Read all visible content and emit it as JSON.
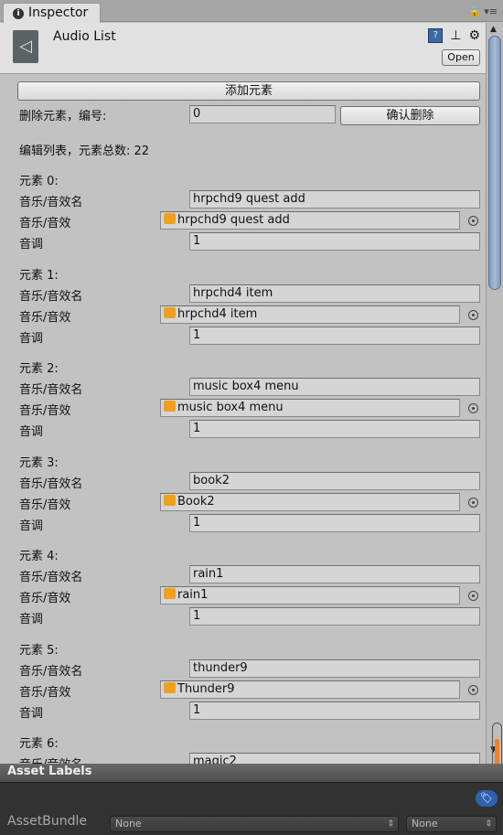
{
  "tab": {
    "label": "Inspector"
  },
  "header": {
    "title": "Audio List",
    "open_label": "Open"
  },
  "controls": {
    "add_label": "添加元素",
    "delete_label": "删除元素，编号:",
    "delete_index": "0",
    "confirm_delete_label": "确认删除",
    "list_summary": "编辑列表，元素总数: 22"
  },
  "field_labels": {
    "name": "音乐/音效名",
    "clip": "音乐/音效",
    "pitch": "音调"
  },
  "elements": [
    {
      "header": "元素 0:",
      "name": "hrpchd9 quest add",
      "clip": "hrpchd9 quest add",
      "pitch": "1"
    },
    {
      "header": "元素 1:",
      "name": "hrpchd4 item",
      "clip": "hrpchd4 item",
      "pitch": "1"
    },
    {
      "header": "元素 2:",
      "name": "music box4 menu",
      "clip": "music box4 menu",
      "pitch": "1"
    },
    {
      "header": "元素 3:",
      "name": "book2",
      "clip": "Book2",
      "pitch": "1"
    },
    {
      "header": "元素 4:",
      "name": "rain1",
      "clip": "rain1",
      "pitch": "1"
    },
    {
      "header": "元素 5:",
      "name": "thunder9",
      "clip": "Thunder9",
      "pitch": "1"
    },
    {
      "header": "元素 6:",
      "name": "magic2",
      "clip": "",
      "pitch": ""
    }
  ],
  "asset_labels": {
    "title": "Asset Labels",
    "assetbundle_label": "AssetBundle",
    "bundle_value": "None",
    "variant_value": "None"
  },
  "colors": {
    "audio_icon": "#f0a020",
    "scroll_indicator": "#f08020",
    "tag_button": "#2e62b0"
  }
}
